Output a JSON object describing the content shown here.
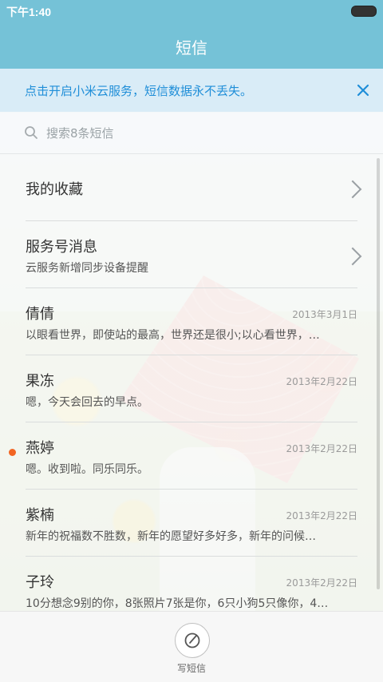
{
  "status": {
    "time": "下午1:40"
  },
  "header": {
    "title": "短信"
  },
  "banner": {
    "text": "点击开启小米云服务，短信数据永不丢失。"
  },
  "search": {
    "placeholder": "搜索8条短信"
  },
  "conversations": [
    {
      "name": "我的收藏",
      "preview": "",
      "date": "",
      "chevron": true,
      "unread": false
    },
    {
      "name": "服务号消息",
      "preview": "云服务新增同步设备提醒",
      "date": "",
      "chevron": true,
      "unread": false
    },
    {
      "name": "倩倩",
      "preview": "以眼看世界，即使站的最高，世界还是很小;以心看世界，…",
      "date": "2013年3月1日",
      "chevron": false,
      "unread": false
    },
    {
      "name": "果冻",
      "preview": "嗯，今天会回去的早点。",
      "date": "2013年2月22日",
      "chevron": false,
      "unread": false
    },
    {
      "name": "燕婷",
      "preview": "嗯。收到啦。同乐同乐。",
      "date": "2013年2月22日",
      "chevron": false,
      "unread": true
    },
    {
      "name": "紫楠",
      "preview": "新年的祝福数不胜数，新年的愿望好多好多，新年的问候…",
      "date": "2013年2月22日",
      "chevron": false,
      "unread": false
    },
    {
      "name": "子玲",
      "preview": "10分想念9别的你，8张照片7张是你，6只小狗5只像你，4…",
      "date": "2013年2月22日",
      "chevron": false,
      "unread": false
    }
  ],
  "bottom": {
    "compose_label": "写短信"
  },
  "colors": {
    "header": "#75c2d7",
    "accent": "#1f8ed8",
    "unread": "#f26522"
  }
}
